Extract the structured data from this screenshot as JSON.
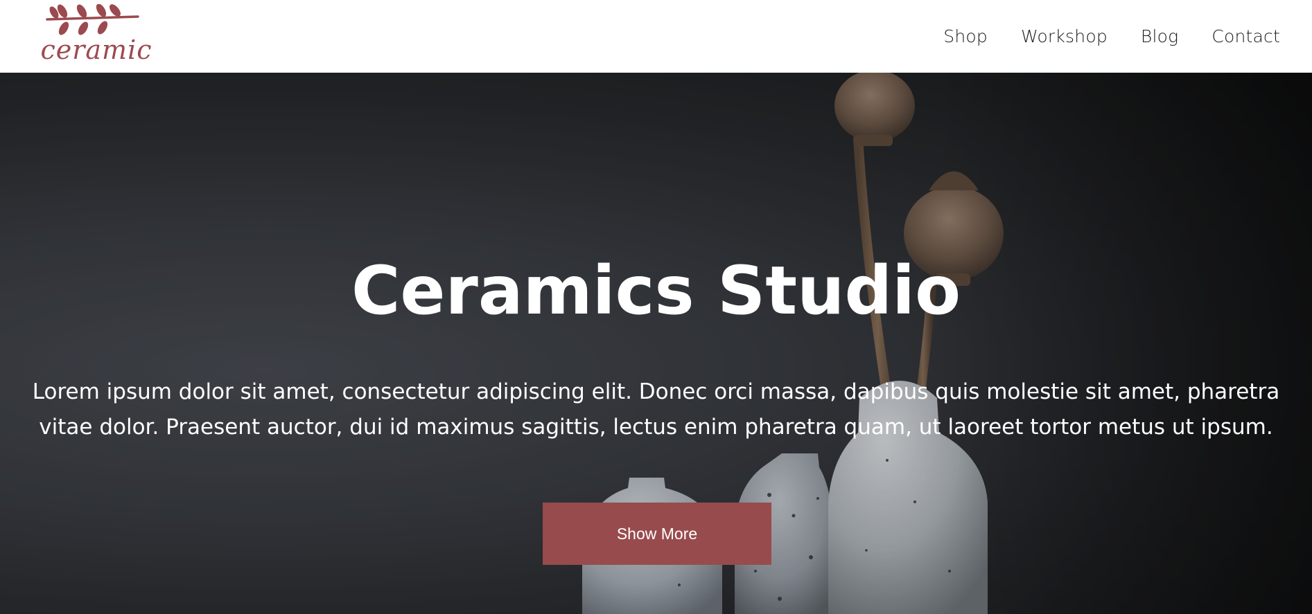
{
  "brand": {
    "logo_text": "ceramic",
    "accent_color": "#984b4d"
  },
  "nav": {
    "items": [
      {
        "label": "Shop"
      },
      {
        "label": "Workshop"
      },
      {
        "label": "Blog"
      },
      {
        "label": "Contact"
      }
    ]
  },
  "hero": {
    "title": "Ceramics Studio",
    "body": "Lorem ipsum dolor sit amet, consectetur adipiscing elit. Donec orci massa, dapibus quis molestie sit amet, pharetra vitae dolor. Praesent auctor, dui id maximus sagittis, lectus enim pharetra quam, ut laoreet tortor metus ut ipsum.",
    "cta_label": "Show More"
  },
  "icons": {
    "logo_mark": "olive-branch-icon"
  }
}
